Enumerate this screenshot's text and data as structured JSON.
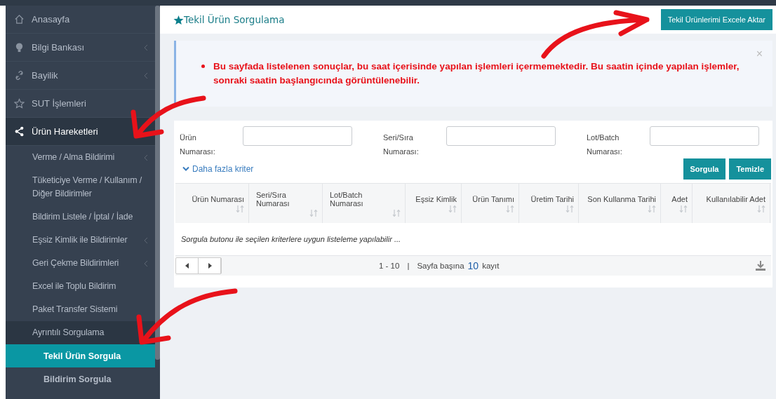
{
  "sidebar": {
    "items": [
      {
        "label": "Anasayfa",
        "has_arrow": false,
        "selected": false
      },
      {
        "label": "Bilgi Bankası",
        "has_arrow": true,
        "selected": false
      },
      {
        "label": "Bayilik",
        "has_arrow": true,
        "selected": false
      },
      {
        "label": "SUT İşlemleri",
        "has_arrow": false,
        "selected": false
      },
      {
        "label": "Ürün Hareketleri",
        "has_arrow": false,
        "selected": true,
        "children": [
          {
            "label": "Verme / Alma Bildirimi",
            "has_arrow": true,
            "selected": false
          },
          {
            "label": "Tüketiciye Verme / Kullanım / Diğer Bildirimler",
            "has_arrow": false,
            "selected": false
          },
          {
            "label": "Bildirim Listele / İptal / İade",
            "has_arrow": false,
            "selected": false
          },
          {
            "label": "Eşsiz Kimlik ile Bildirimler",
            "has_arrow": true,
            "selected": false
          },
          {
            "label": "Geri Çekme Bildirimleri",
            "has_arrow": true,
            "selected": false
          },
          {
            "label": "Excel ile Toplu Bildirim",
            "has_arrow": false,
            "selected": false
          },
          {
            "label": "Paket Transfer Sistemi",
            "has_arrow": false,
            "selected": false
          },
          {
            "label": "Ayrıntılı Sorgulama",
            "has_arrow": false,
            "selected": true,
            "children": [
              {
                "label": "Tekil Ürün Sorgula",
                "selected": true
              },
              {
                "label": "Bildirim Sorgula",
                "selected": false
              }
            ]
          }
        ]
      }
    ]
  },
  "page": {
    "title": "Tekil Ürün Sorgulama",
    "export_button": "Tekil Ürünlerimi Excele Aktar"
  },
  "alert": {
    "message": "Bu sayfada listelenen sonuçlar, bu saat içerisinde yapılan işlemleri içermemektedir. Bu saatin içinde yapılan işlemler, sonraki saatin başlangıcında görüntülenebilir.",
    "close": "×"
  },
  "filters": [
    {
      "label": "Ürün Numarası:"
    },
    {
      "label": "Seri/Sıra Numarası:"
    },
    {
      "label": "Lot/Batch Numarası:"
    }
  ],
  "more_criteria": "Daha fazla kriter",
  "buttons": [
    "Sorgula",
    "Temizle"
  ],
  "table": {
    "columns": [
      "Ürün Numarası",
      "Seri/Sıra Numarası",
      "Lot/Batch Numarası",
      "Eşsiz Kimlik",
      "Ürün Tanımı",
      "Üretim Tarihi",
      "Son Kullanma Tarihi",
      "Adet",
      "Kullanılabilir Adet"
    ],
    "empty_message": "Sorgula butonu ile seçilen kriterlere uygun listeleme yapılabilir ..."
  },
  "pager": {
    "range": "1 - 10",
    "separator": "|",
    "per_page_label": "Sayfa başına",
    "per_page": "10",
    "unit": "kayıt"
  }
}
